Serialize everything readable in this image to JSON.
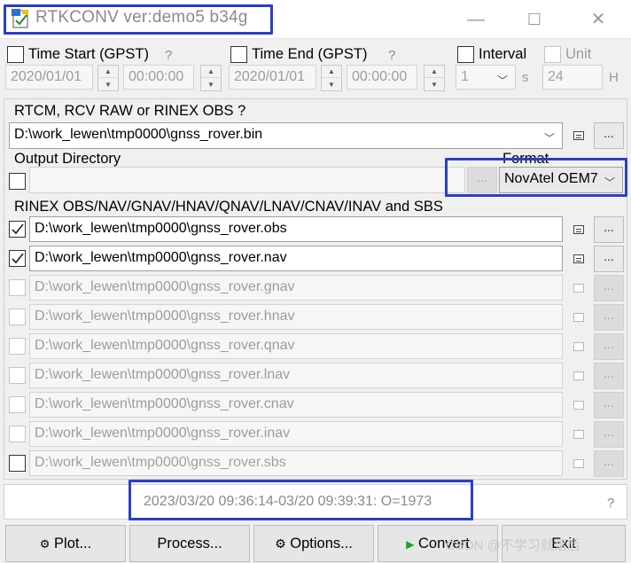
{
  "title": "RTKCONV ver:demo5 b34g",
  "window_controls": {
    "minimize": "—",
    "maximize": "☐",
    "close": "✕"
  },
  "time": {
    "start_label": "Time Start (GPST)",
    "end_label": "Time End (GPST)",
    "help": "?",
    "start_date": "2020/01/01",
    "start_time": "00:00:00",
    "end_date": "2020/01/01",
    "end_time": "00:00:00",
    "interval_label": "Interval",
    "interval_value": "1",
    "interval_unit": "s",
    "unit_label": "Unit",
    "unit_value": "24",
    "unit_unit": "H"
  },
  "input": {
    "label": "RTCM, RCV RAW or RINEX OBS ?",
    "path": "D:\\work_lewen\\tmp0000\\gnss_rover.bin",
    "browse": "..."
  },
  "output": {
    "label": "Output Directory",
    "path": "",
    "browse": "...",
    "format_label": "Format",
    "format_value": "NovAtel OEM7"
  },
  "rinex": {
    "label": "RINEX OBS/NAV/GNAV/HNAV/QNAV/LNAV/CNAV/INAV and SBS",
    "files": [
      {
        "path": "D:\\work_lewen\\tmp0000\\gnss_rover.obs",
        "checked": true,
        "enabled": true
      },
      {
        "path": "D:\\work_lewen\\tmp0000\\gnss_rover.nav",
        "checked": true,
        "enabled": true
      },
      {
        "path": "D:\\work_lewen\\tmp0000\\gnss_rover.gnav",
        "checked": false,
        "enabled": false
      },
      {
        "path": "D:\\work_lewen\\tmp0000\\gnss_rover.hnav",
        "checked": false,
        "enabled": false
      },
      {
        "path": "D:\\work_lewen\\tmp0000\\gnss_rover.qnav",
        "checked": false,
        "enabled": false
      },
      {
        "path": "D:\\work_lewen\\tmp0000\\gnss_rover.lnav",
        "checked": false,
        "enabled": false
      },
      {
        "path": "D:\\work_lewen\\tmp0000\\gnss_rover.cnav",
        "checked": false,
        "enabled": false
      },
      {
        "path": "D:\\work_lewen\\tmp0000\\gnss_rover.inav",
        "checked": false,
        "enabled": false
      },
      {
        "path": "D:\\work_lewen\\tmp0000\\gnss_rover.sbs",
        "checked": false,
        "enabled": true
      }
    ]
  },
  "status": {
    "text": "2023/03/20 09:36:14-03/20 09:39:31: O=1973",
    "help": "?"
  },
  "buttons": {
    "plot": "Plot...",
    "process": "Process...",
    "options": "Options...",
    "convert": "Convert",
    "exit": "Exit"
  },
  "watermark": "CSDN @不学习就落后",
  "colors": {
    "highlight": "#2b3fc7",
    "convert_icon": "#1aa32a"
  }
}
